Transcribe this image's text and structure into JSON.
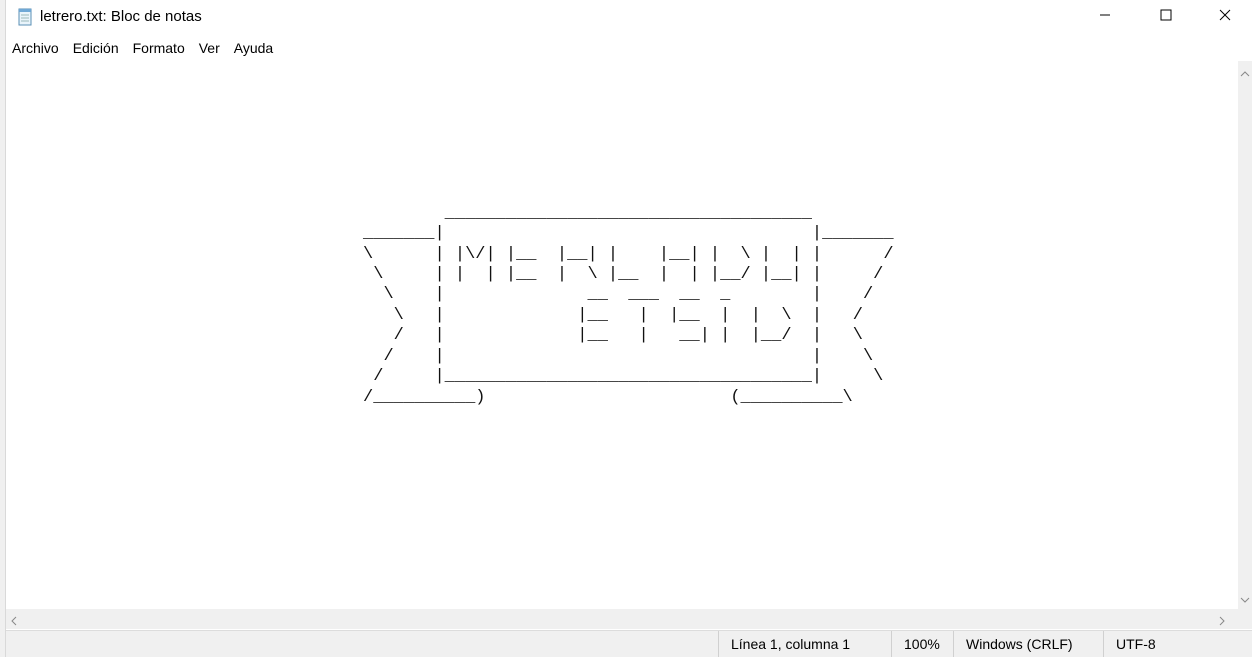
{
  "window": {
    "title": "letrero.txt: Bloc de notas"
  },
  "menu": {
    "items": [
      "Archivo",
      "Edición",
      "Formato",
      "Ver",
      "Ayuda"
    ]
  },
  "editor": {
    "content": "\n\n\n\n\n\n\n                                           ____________________________________\n                                   _______|                                    |_______\n                                   \\      | |\\/| |__  |__| |    |__| |  \\ |  | |      /\n                                    \\     | |  | |__  |  \\ |__  |  | |__/ |__| |     /\n                                     \\    |              __  ___  __  _        |    /\n                                      \\   |             |__   |  |__  |  |  \\  |   /\n                                      /   |             |__   |   __| |  |__/  |   \\\n                                     /    |                                    |    \\\n                                    /     |____________________________________|     \\\n                                   /__________)                        (__________\\"
  },
  "status": {
    "position": "Línea 1, columna 1",
    "zoom": "100%",
    "line_ending": "Windows (CRLF)",
    "encoding": "UTF-8"
  },
  "icons": {
    "app": "notepad-icon",
    "minimize": "minimize-icon",
    "maximize": "maximize-icon",
    "close": "close-icon"
  }
}
